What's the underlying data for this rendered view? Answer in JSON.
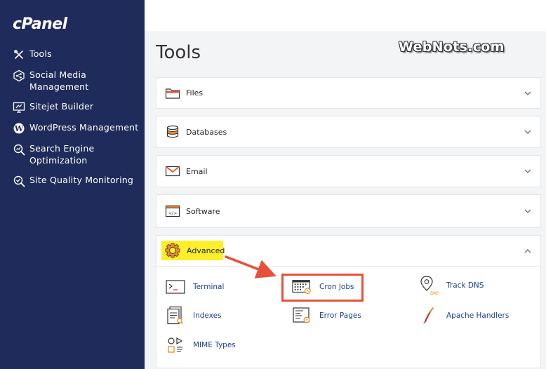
{
  "brand": {
    "logo": "cPanel",
    "watermark": "WebNots.com"
  },
  "sidebar": {
    "items": [
      {
        "label": "Tools",
        "icon": "tools-icon"
      },
      {
        "label": "Social Media Management",
        "icon": "social-media-icon"
      },
      {
        "label": "Sitejet Builder",
        "icon": "sitejet-icon"
      },
      {
        "label": "WordPress Management",
        "icon": "wordpress-icon"
      },
      {
        "label": "Search Engine Optimization",
        "icon": "seo-icon"
      },
      {
        "label": "Site Quality Monitoring",
        "icon": "site-quality-icon"
      }
    ]
  },
  "main": {
    "title": "Tools",
    "sections": [
      {
        "title": "Files",
        "icon": "folder-icon"
      },
      {
        "title": "Databases",
        "icon": "database-icon"
      },
      {
        "title": "Email",
        "icon": "email-icon"
      },
      {
        "title": "Software",
        "icon": "software-icon"
      }
    ],
    "advanced": {
      "title": "Advanced",
      "tools": [
        {
          "label": "Terminal",
          "icon": "terminal-icon"
        },
        {
          "label": "Cron Jobs",
          "icon": "cron-jobs-icon"
        },
        {
          "label": "Track DNS",
          "icon": "track-dns-icon"
        },
        {
          "label": "Indexes",
          "icon": "indexes-icon"
        },
        {
          "label": "Error Pages",
          "icon": "error-pages-icon"
        },
        {
          "label": "Apache Handlers",
          "icon": "apache-handlers-icon"
        },
        {
          "label": "MIME Types",
          "icon": "mime-types-icon"
        }
      ]
    }
  },
  "colors": {
    "sidebar": "#1f2b5a",
    "accent": "#f08a24",
    "link": "#1c3f8f",
    "highlight": "#ffef2a",
    "annotation": "#e8503a"
  },
  "icon_text": {
    "dns": "DNS"
  }
}
